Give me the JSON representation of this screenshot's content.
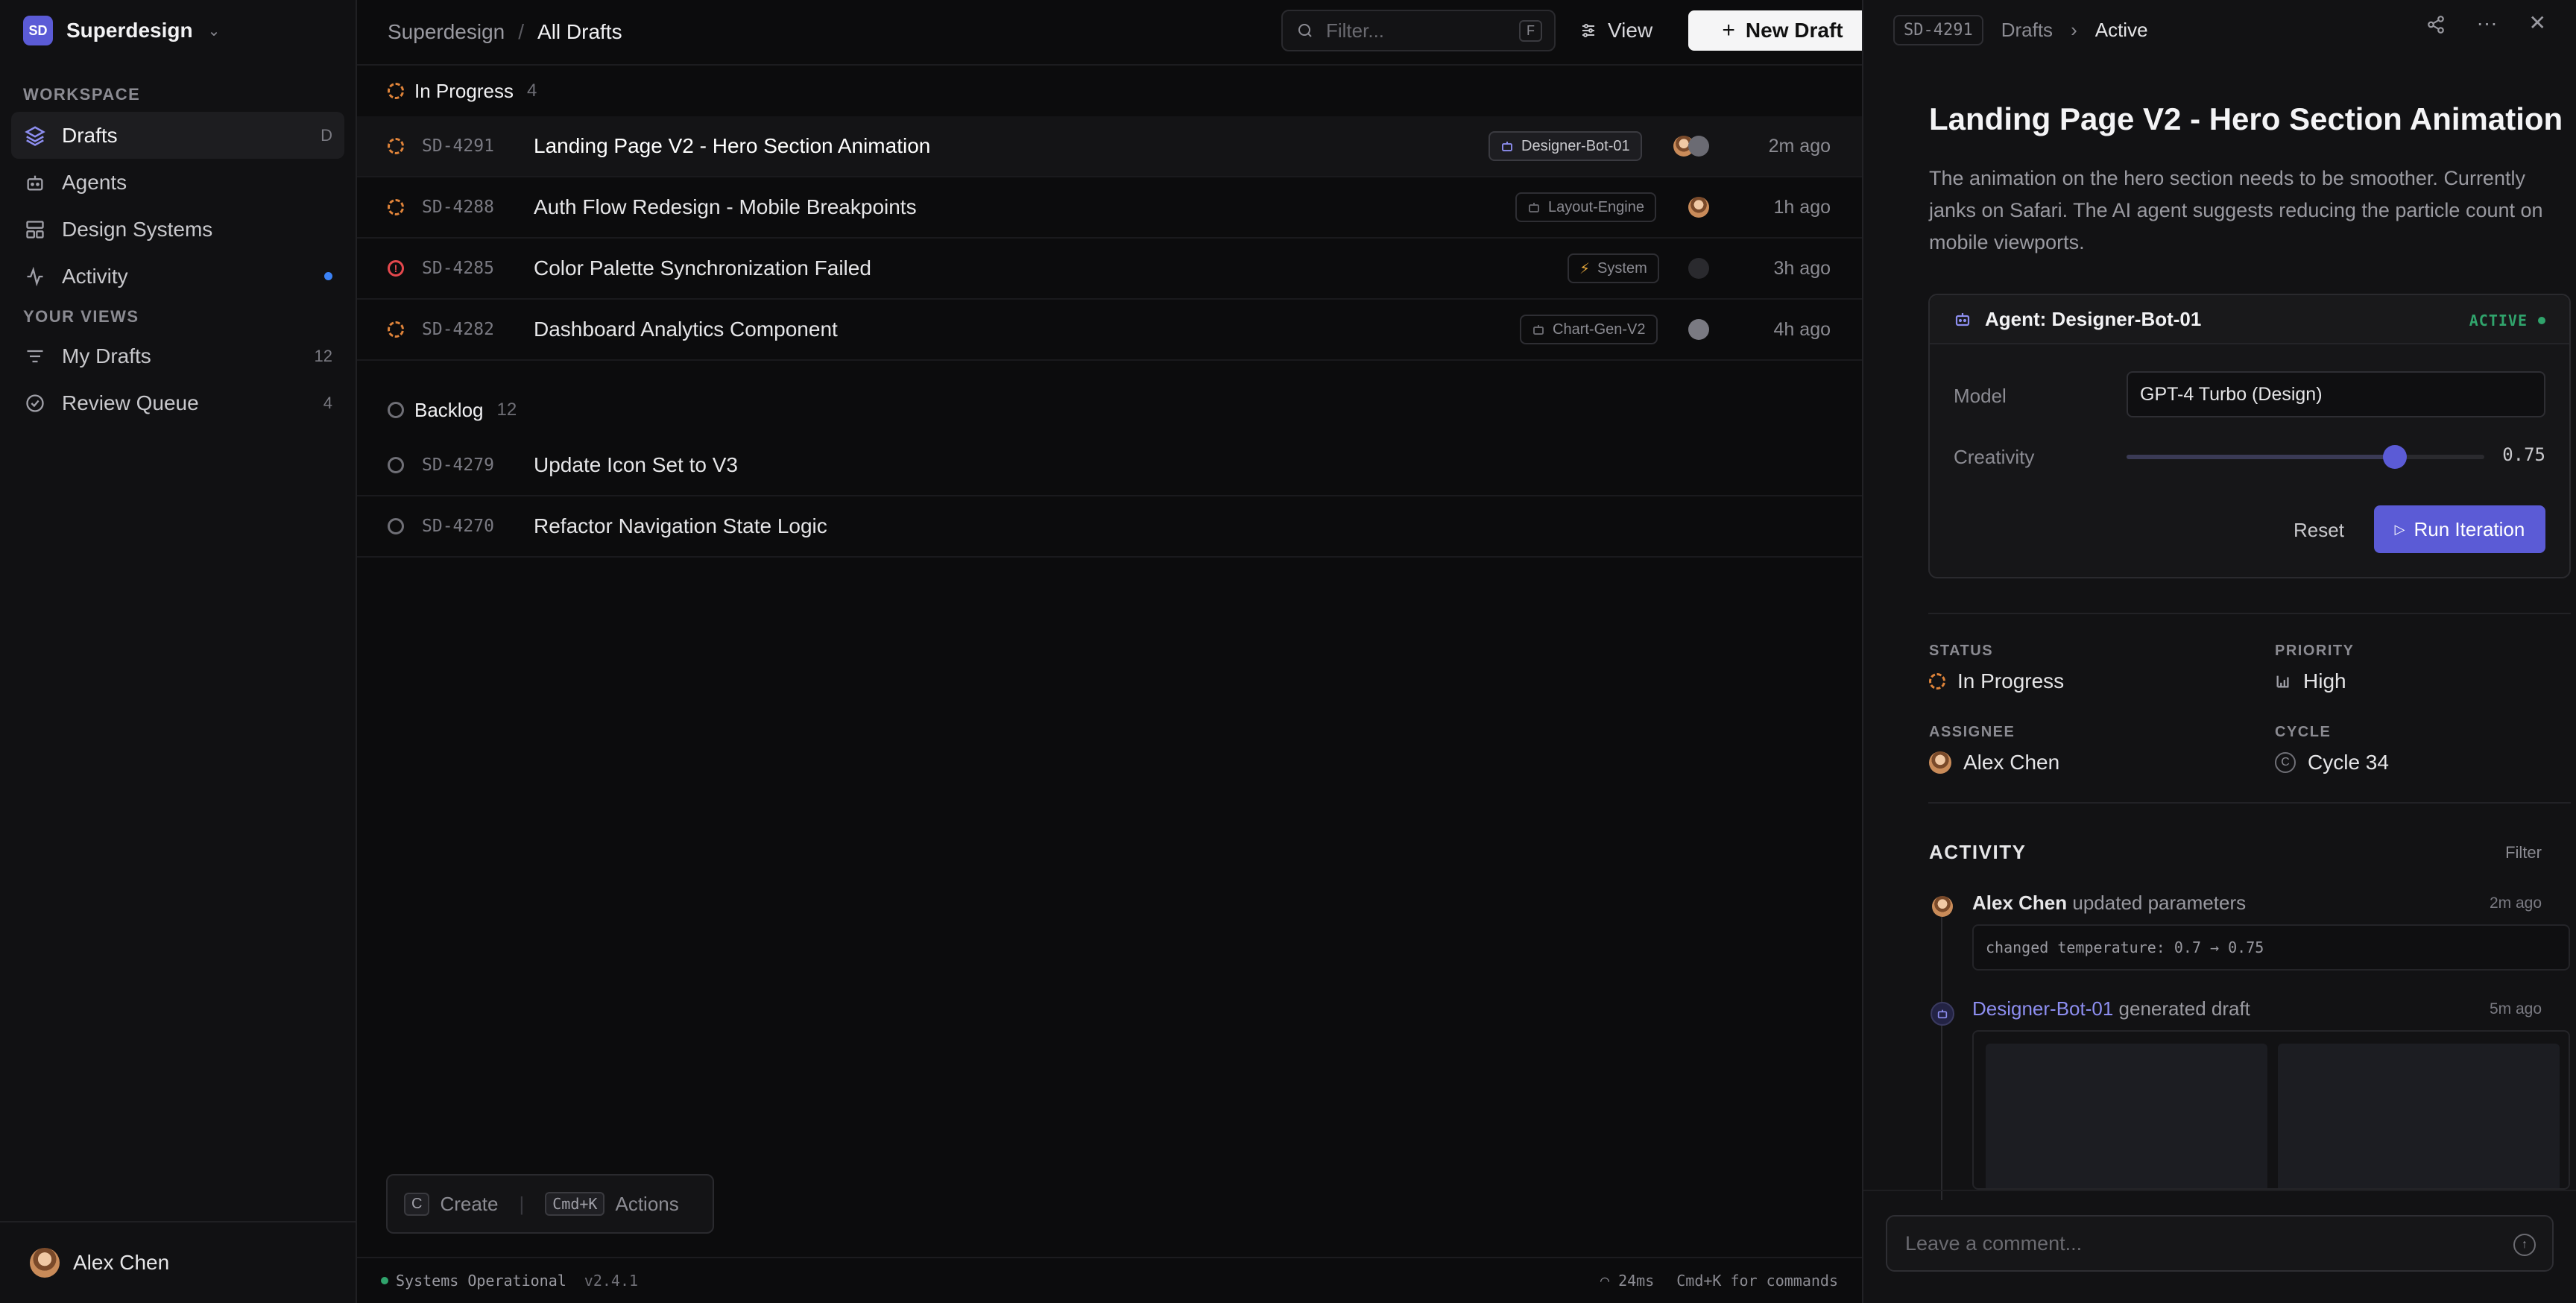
{
  "workspace": {
    "logo": "SD",
    "name": "Superdesign"
  },
  "sidebar": {
    "section_workspace": "WORKSPACE",
    "section_views": "YOUR VIEWS",
    "items": [
      {
        "label": "Drafts",
        "badge": "D",
        "icon": "layers-icon"
      },
      {
        "label": "Agents",
        "icon": "bot-icon"
      },
      {
        "label": "Design Systems",
        "icon": "layout-icon"
      },
      {
        "label": "Activity",
        "icon": "activity-icon"
      }
    ],
    "views": [
      {
        "label": "My Drafts",
        "count": "12",
        "icon": "filter-lines-icon"
      },
      {
        "label": "Review Queue",
        "count": "4",
        "icon": "check-circle-icon"
      }
    ],
    "user": "Alex Chen"
  },
  "header": {
    "crumb_root": "Superdesign",
    "crumb_sep": "/",
    "crumb_current": "All Drafts",
    "filter_placeholder": "Filter...",
    "filter_key": "F",
    "view_label": "View",
    "new_label": "New Draft"
  },
  "groups": {
    "in_progress": {
      "label": "In Progress",
      "count": "4"
    },
    "backlog": {
      "label": "Backlog",
      "count": "12"
    }
  },
  "rows": [
    {
      "id": "SD-4291",
      "title": "Landing Page V2 - Hero Section Animation",
      "tag": "Designer-Bot-01",
      "time": "2m ago"
    },
    {
      "id": "SD-4288",
      "title": "Auth Flow Redesign - Mobile Breakpoints",
      "tag": "Layout-Engine",
      "time": "1h ago"
    },
    {
      "id": "SD-4285",
      "title": "Color Palette Synchronization Failed",
      "tag": "System",
      "time": "3h ago"
    },
    {
      "id": "SD-4282",
      "title": "Dashboard Analytics Component",
      "tag": "Chart-Gen-V2",
      "time": "4h ago"
    }
  ],
  "backlog_rows": [
    {
      "id": "SD-4279",
      "title": "Update Icon Set to V3"
    },
    {
      "id": "SD-4270",
      "title": "Refactor Navigation State Logic"
    }
  ],
  "cmdbar": {
    "create_key": "C",
    "create_label": "Create",
    "sep": "|",
    "actions_key": "Cmd+K",
    "actions_label": "Actions"
  },
  "statusbar": {
    "status": "Systems Operational",
    "version": "v2.4.1",
    "latency": "24ms",
    "hint": "Cmd+K for commands"
  },
  "panel": {
    "id": "SD-4291",
    "crumb": "Drafts",
    "crumb_sep": "›",
    "crumb_current": "Active",
    "title": "Landing Page V2 - Hero Section Animation",
    "description": "The animation on the hero section needs to be smoother. Currently janks on Safari. The AI agent suggests reducing the particle count on mobile viewports.",
    "agent": {
      "name": "Agent: Designer-Bot-01",
      "status": "ACTIVE",
      "model_label": "Model",
      "model_value": "GPT-4 Turbo (Design)",
      "creativity_label": "Creativity",
      "creativity_value": "0.75",
      "creativity_level": 0.75,
      "reset_label": "Reset",
      "run_label": "Run Iteration"
    },
    "props": {
      "status_label": "STATUS",
      "status_value": "In Progress",
      "priority_label": "PRIORITY",
      "priority_value": "High",
      "assignee_label": "ASSIGNEE",
      "assignee_value": "Alex Chen",
      "cycle_label": "CYCLE",
      "cycle_value": "Cycle 34",
      "cycle_glyph": "C"
    },
    "activity": {
      "title": "ACTIVITY",
      "filter_label": "Filter",
      "items": [
        {
          "actor": "Alex Chen",
          "action": "updated parameters",
          "time": "2m ago",
          "detail": "changed temperature: 0.7 → 0.75"
        },
        {
          "actor": "Designer-Bot-01",
          "action": "generated draft",
          "time": "5m ago"
        }
      ]
    },
    "comment_placeholder": "Leave a comment..."
  },
  "colors": {
    "accent": "#5b5bd6",
    "in_progress": "#e0843a",
    "error": "#e5484d",
    "success": "#30a46c"
  }
}
